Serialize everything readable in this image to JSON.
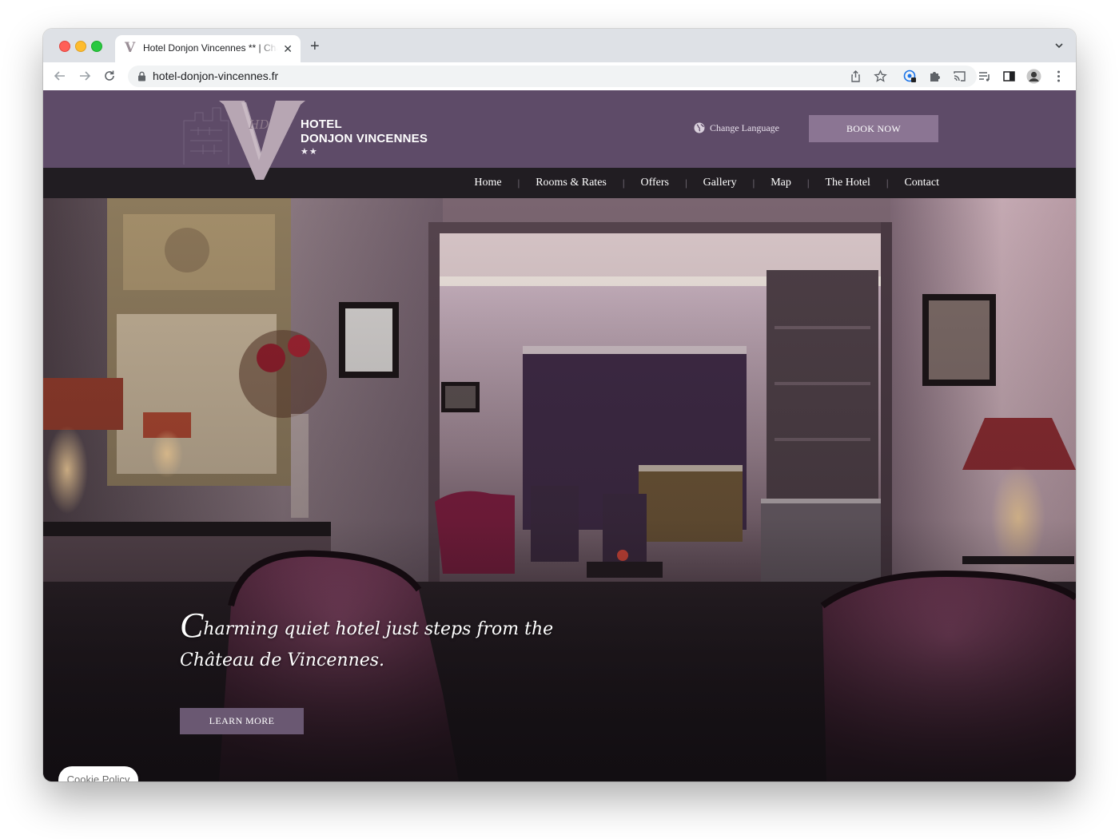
{
  "browser": {
    "tab_title": "Hotel Donjon Vincennes ** | Charming hotel",
    "tab_favicon": "V",
    "url": "hotel-donjon-vincennes.fr"
  },
  "site": {
    "logo_letter": "V",
    "logo_monogram": "HD",
    "logo_line1": "HOTEL",
    "logo_line2": "DONJON VINCENNES",
    "logo_stars": "★★",
    "change_language": "Change Language",
    "book_now": "BOOK NOW",
    "nav": [
      {
        "label": "Home"
      },
      {
        "label": "Rooms & Rates"
      },
      {
        "label": "Offers"
      },
      {
        "label": "Gallery"
      },
      {
        "label": "Map"
      },
      {
        "label": "The Hotel"
      },
      {
        "label": "Contact"
      }
    ],
    "hero": {
      "tagline_initial": "C",
      "tagline_line1_rest": "harming quiet hotel just steps from the",
      "tagline_line2": "Château de Vincennes.",
      "learn_more": "LEARN MORE"
    },
    "cookie_policy": "Cookie Policy"
  },
  "colors": {
    "header_purple": "#5e4b68",
    "nav_dark": "#211d22",
    "book_button": "#8b7593",
    "learn_button": "#6a5872"
  }
}
